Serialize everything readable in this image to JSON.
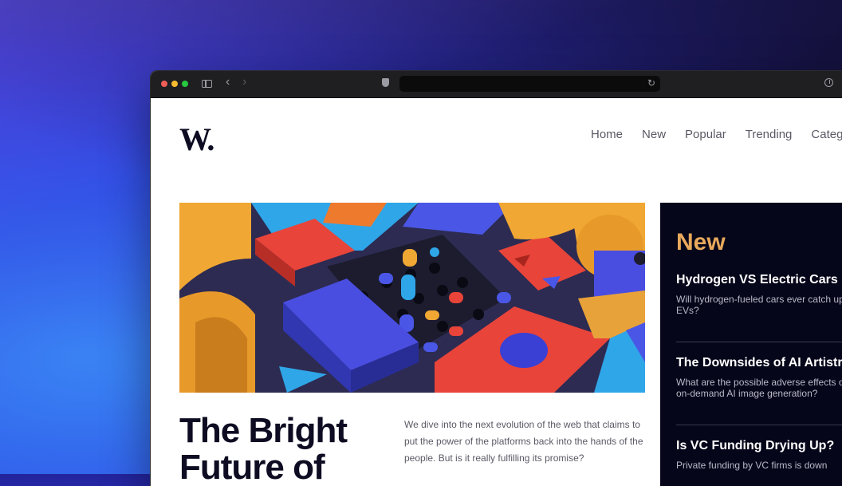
{
  "site": {
    "logo": "W.",
    "nav": [
      "Home",
      "New",
      "Popular",
      "Trending",
      "Categories"
    ]
  },
  "hero": {
    "headline": "The Bright Future of",
    "excerpt": "We dive into the next evolution of the web that claims to put the power of the platforms back into the hands of the people. But is it really fulfilling its promise?"
  },
  "new_panel": {
    "title": "New",
    "items": [
      {
        "title": "Hydrogen VS Electric Cars",
        "desc": "Will hydrogen-fueled cars ever catch up to EVs?"
      },
      {
        "title": "The Downsides of AI Artistry",
        "desc": "What are the possible adverse effects of on-demand AI image generation?"
      },
      {
        "title": "Is VC Funding Drying Up?",
        "desc": "Private funding by VC firms is down"
      }
    ]
  },
  "colors": {
    "accent": "#e8a95c",
    "ink": "#0d0c22",
    "panel_bg": "#06061a"
  }
}
